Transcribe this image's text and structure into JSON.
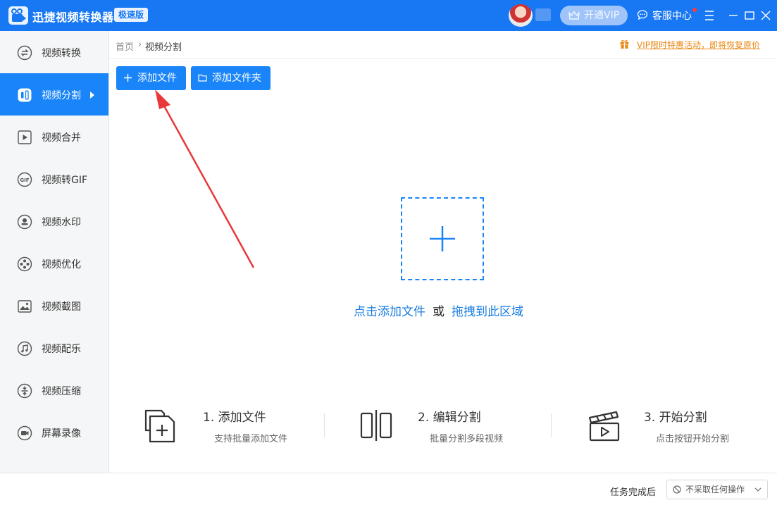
{
  "app": {
    "title": "迅捷视频转换器",
    "edition": "极速版",
    "vip_label": "开通VIP",
    "service_label": "客服中心"
  },
  "sidebar": {
    "items": [
      {
        "label": "视频转换",
        "icon": "convert-icon"
      },
      {
        "label": "视频分割",
        "icon": "split-icon",
        "active": true
      },
      {
        "label": "视频合并",
        "icon": "merge-icon"
      },
      {
        "label": "视频转GIF",
        "icon": "gif-icon"
      },
      {
        "label": "视频水印",
        "icon": "watermark-icon"
      },
      {
        "label": "视频优化",
        "icon": "optimize-icon"
      },
      {
        "label": "视频截图",
        "icon": "screenshot-icon"
      },
      {
        "label": "视频配乐",
        "icon": "music-icon"
      },
      {
        "label": "视频压缩",
        "icon": "compress-icon"
      },
      {
        "label": "屏幕录像",
        "icon": "record-icon"
      }
    ]
  },
  "breadcrumb": {
    "home": "首页",
    "separator": "›",
    "current": "视频分割"
  },
  "promo": {
    "text": "VIP限时特惠活动，即将恢复原价"
  },
  "toolbar": {
    "add_file": "添加文件",
    "add_folder": "添加文件夹"
  },
  "drop": {
    "click_text": "点击添加文件",
    "or": "或",
    "drag_text": "拖拽到此区域"
  },
  "steps": [
    {
      "title": "1. 添加文件",
      "desc": "支持批量添加文件"
    },
    {
      "title": "2. 编辑分割",
      "desc": "批量分割多段视频"
    },
    {
      "title": "3. 开始分割",
      "desc": "点击按钮开始分割"
    }
  ],
  "footer": {
    "label": "任务完成后",
    "selected": "不采取任何操作"
  },
  "colors": {
    "brand": "#1877f2",
    "accent": "#1a85f8",
    "promo": "#e98a18",
    "annotation_arrow": "#e8383a"
  }
}
